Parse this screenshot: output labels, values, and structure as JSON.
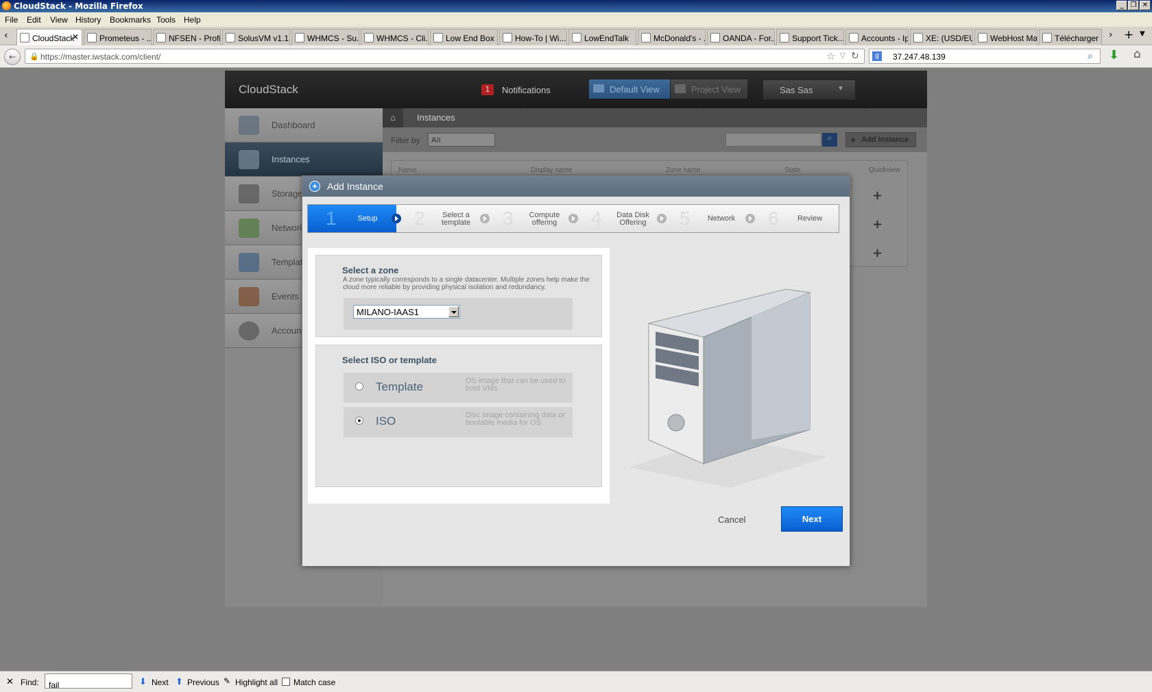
{
  "window": {
    "title": "CloudStack - Mozilla Firefox"
  },
  "menu": [
    "File",
    "Edit",
    "View",
    "History",
    "Bookmarks",
    "Tools",
    "Help"
  ],
  "tabs": [
    "CloudStack",
    "Prometeus - ...",
    "NFSEN - Profi...",
    "SolusVM v1.1...",
    "WHMCS - Su...",
    "WHMCS - Cli...",
    "Low End Box ...",
    "How-To | Wi...",
    "LowEndTalk",
    "McDonald's - ...",
    "OANDA - For...",
    "Support Tick...",
    "Accounts - Ip...",
    "XE: (USD/EU...",
    "WebHost Ma...",
    "Télécharger ..."
  ],
  "nav": {
    "url": "https://master.iwstack.com/client/",
    "search": "37.247.48.139"
  },
  "app": {
    "logo": "CloudStack",
    "notifications": {
      "count": "1",
      "label": "Notifications"
    },
    "views": {
      "default": "Default View",
      "project": "Project View"
    },
    "user": "Sas Sas",
    "sidebar": [
      "Dashboard",
      "Instances",
      "Storage",
      "Network",
      "Templates",
      "Events",
      "Accounts"
    ],
    "breadcrumb": "Instances",
    "filter": {
      "label": "Filter by",
      "value": "All"
    },
    "add_instance": "Add Instance",
    "columns": [
      "Name",
      "Display name",
      "Zone name",
      "State",
      "Quickview"
    ]
  },
  "modal": {
    "title": "Add Instance",
    "steps": [
      {
        "num": "1",
        "label": "Setup"
      },
      {
        "num": "2",
        "label": "Select a template"
      },
      {
        "num": "3",
        "label": "Compute offering"
      },
      {
        "num": "4",
        "label": "Data Disk Offering"
      },
      {
        "num": "5",
        "label": "Network"
      },
      {
        "num": "6",
        "label": "Review"
      }
    ],
    "zone": {
      "heading": "Select a zone",
      "description": "A zone typically corresponds to a single datacenter. Multiple zones help make the cloud more reliable by providing physical isolation and redundancy.",
      "selected": "MILANO-IAAS1"
    },
    "source": {
      "heading": "Select ISO or template",
      "options": [
        {
          "name": "Template",
          "desc": "OS image that can be used to boot VMs",
          "selected": false
        },
        {
          "name": "ISO",
          "desc": "Disc image containing data or bootable media for OS",
          "selected": true
        }
      ]
    },
    "cancel": "Cancel",
    "next": "Next"
  },
  "find": {
    "label": "Find:",
    "value": "fail",
    "next": "Next",
    "previous": "Previous",
    "highlight": "Highlight all",
    "match_case": "Match case"
  }
}
